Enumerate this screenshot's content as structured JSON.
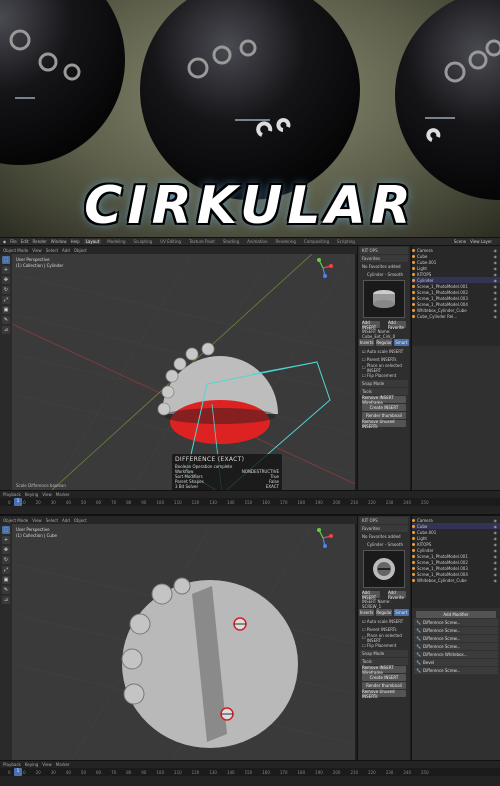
{
  "banner": {
    "title": "CIRKULAR"
  },
  "app": {
    "menus": [
      "File",
      "Edit",
      "Render",
      "Window",
      "Help"
    ],
    "tabs": [
      "Layout",
      "Modeling",
      "Sculpting",
      "UV Editing",
      "Texture Paint",
      "Shading",
      "Animation",
      "Rendering",
      "Compositing",
      "Scripting"
    ],
    "scene": "Scene",
    "view_layer": "View Layer"
  },
  "viewport_header": [
    "Object Mode",
    "View",
    "Select",
    "Add",
    "Object"
  ],
  "shot1": {
    "view_label": "User Perspective",
    "collection_label": "(1) Collection | Cylinder",
    "operator": {
      "title": "DIFFERENCE (EXACT)",
      "lines": [
        {
          "k": "Boolean Operation complete",
          "v": ""
        },
        {
          "k": "Workflow",
          "v": "NONDESTRUCTIVE"
        },
        {
          "k": "Sort Modifiers",
          "v": "True"
        },
        {
          "k": "Parent Shapes",
          "v": "False"
        },
        {
          "k": "3 Bit Solver",
          "v": "EXACT"
        }
      ]
    },
    "npanel": {
      "header": "KIT OPS",
      "subheader": "Favorites",
      "hint": "No Favorites added",
      "preview_name": "Cylinder - Smooth",
      "buttons": [
        "Add INSERT",
        "Add Favorite"
      ],
      "insert_name_label": "INSERT Name: Cube_Ext_Cirk_0",
      "modes": [
        "Inserts",
        "Regular",
        "Smart"
      ],
      "options": [
        "Auto scale INSERT",
        "Parent INSERTs",
        "Place on selected INSERT",
        "Flip Placement"
      ],
      "snap_label": "Snap Mode",
      "tools_label": "Tools",
      "tool_buttons": [
        "Remove INSERT Wireframe",
        "Create INSERT",
        "Render thumbnail",
        "Remove Unused INSERTs"
      ]
    },
    "outliner": [
      {
        "name": "Camera",
        "sel": false
      },
      {
        "name": "Cube",
        "sel": false
      },
      {
        "name": "Cube.001",
        "sel": false
      },
      {
        "name": "Light",
        "sel": false
      },
      {
        "name": "KITOPS",
        "sel": false
      },
      {
        "name": "Cylinder",
        "sel": true
      },
      {
        "name": "Screw_1_PhotoModel.001",
        "sel": false
      },
      {
        "name": "Screw_1_PhotoModel.002",
        "sel": false
      },
      {
        "name": "Screw_1_PhotoModel.003",
        "sel": false
      },
      {
        "name": "Screw_1_PhotoModel.004",
        "sel": false
      },
      {
        "name": "Whitebox_Cylinder_Cube",
        "sel": false
      },
      {
        "name": "Cube_Cylinder Rel...",
        "sel": false
      }
    ],
    "status_text": "Scale Difference boolean",
    "frames": [
      "0",
      "10",
      "20",
      "30",
      "40",
      "50",
      "60",
      "70",
      "80",
      "90",
      "100",
      "110",
      "120",
      "130",
      "140",
      "150",
      "160",
      "170",
      "180",
      "190",
      "200",
      "210",
      "220",
      "230",
      "240",
      "250"
    ],
    "current_frame": "1"
  },
  "shot2": {
    "view_label": "User Perspective",
    "collection_label": "(1) Collection | Cube",
    "npanel": {
      "header": "KIT OPS",
      "subheader": "Favorites",
      "hint": "No Favorites added",
      "preview_name": "Cylinder - Smooth",
      "buttons": [
        "Add INSERT",
        "Add Favorite"
      ],
      "insert_name_label": "INSERT Name: SCREW_1",
      "modes": [
        "Inserts",
        "Regular",
        "Smart"
      ],
      "options": [
        "Auto scale INSERT",
        "Parent INSERTs",
        "Place on selected INSERT",
        "Flip Placement"
      ],
      "snap_label": "Snap Mode",
      "tools_label": "Tools",
      "tool_buttons": [
        "Remove INSERT Wireframe",
        "Create INSERT",
        "Render thumbnail",
        "Remove Unused INSERTs"
      ]
    },
    "outliner": [
      {
        "name": "Camera",
        "sel": false
      },
      {
        "name": "Cube",
        "sel": true
      },
      {
        "name": "Cube.001",
        "sel": false
      },
      {
        "name": "Light",
        "sel": false
      },
      {
        "name": "KITOPS",
        "sel": false
      },
      {
        "name": "Cylinder",
        "sel": false
      },
      {
        "name": "Screw_1_PhotoModel.001",
        "sel": false
      },
      {
        "name": "Screw_1_PhotoModel.002",
        "sel": false
      },
      {
        "name": "Screw_1_PhotoModel.003",
        "sel": false
      },
      {
        "name": "Screw_1_PhotoModel.004",
        "sel": false
      },
      {
        "name": "Whitebox_Cylinder_Cube",
        "sel": false
      }
    ],
    "modifiers_header": "Add Modifier",
    "modifiers": [
      "Difference Screw...",
      "Difference Screw...",
      "Difference Screw...",
      "Difference Screw...",
      "Difference Whitebox...",
      "Bevel",
      "Difference Screw..."
    ],
    "frames": [
      "0",
      "10",
      "20",
      "30",
      "40",
      "50",
      "60",
      "70",
      "80",
      "90",
      "100",
      "110",
      "120",
      "130",
      "140",
      "150",
      "160",
      "170",
      "180",
      "190",
      "200",
      "210",
      "220",
      "230",
      "240",
      "250"
    ],
    "current_frame": "1"
  },
  "timeline": {
    "labels": [
      "Playback",
      "Keying",
      "View",
      "Marker"
    ]
  },
  "colors": {
    "accent": "#4a72b0",
    "boolean_cut": "#e22b2b",
    "cutter_wire": "#4fd6d6",
    "selected_orange": "#e9a23b"
  }
}
